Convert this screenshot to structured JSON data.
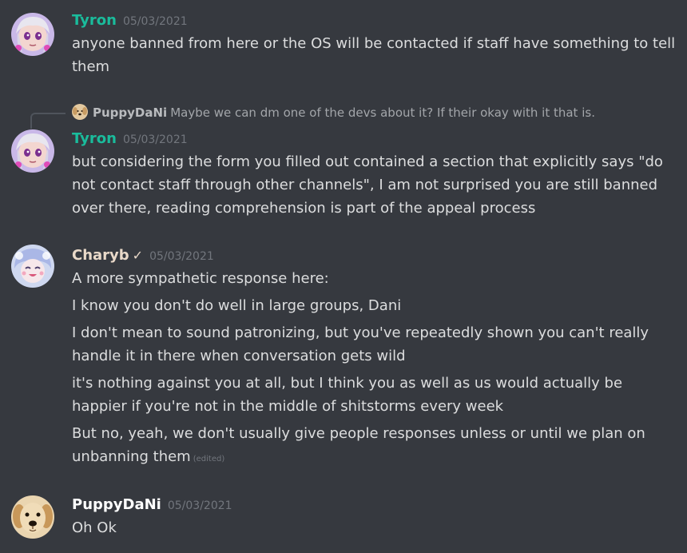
{
  "messages": [
    {
      "author": "Tyron",
      "author_color": "#1abc9c",
      "timestamp": "05/03/2021",
      "lines": [
        "anyone banned from here or the OS will be contacted if staff have something to tell them"
      ]
    },
    {
      "reply": {
        "author": "PuppyDaNi",
        "text": "Maybe we can dm one of the devs about it? If their okay with it that is."
      },
      "author": "Tyron",
      "author_color": "#1abc9c",
      "timestamp": "05/03/2021",
      "lines": [
        "but considering the form you filled out contained a section that explicitly says \"do not contact staff through other channels\", I am not surprised you are still banned over there, reading comprehension is part of the appeal process"
      ]
    },
    {
      "author": "Charyb",
      "verified_glyph": "✓",
      "author_color": "#e9d9c9",
      "timestamp": "05/03/2021",
      "lines": [
        "A more sympathetic response here:",
        "I know you don't do well in large groups, Dani",
        "I don't mean to sound patronizing, but you've repeatedly shown you can't really handle it in there when conversation gets wild",
        "it's nothing against you at all, but I think you as well as us would actually be happier if you're not in the middle of shitstorms every week",
        "But no, yeah, we don't usually give people responses unless or until we plan on unbanning them"
      ],
      "edited_label": "(edited)"
    },
    {
      "author": "PuppyDaNi",
      "author_color": "#ffffff",
      "timestamp": "05/03/2021",
      "lines": [
        "Oh Ok"
      ]
    }
  ],
  "icons": {
    "tyron_avatar": "anime-avatar-icon",
    "charyb_avatar": "cartoon-avatar-icon",
    "puppydani_avatar": "puppy-avatar-icon",
    "verified": "checkmark-icon"
  }
}
